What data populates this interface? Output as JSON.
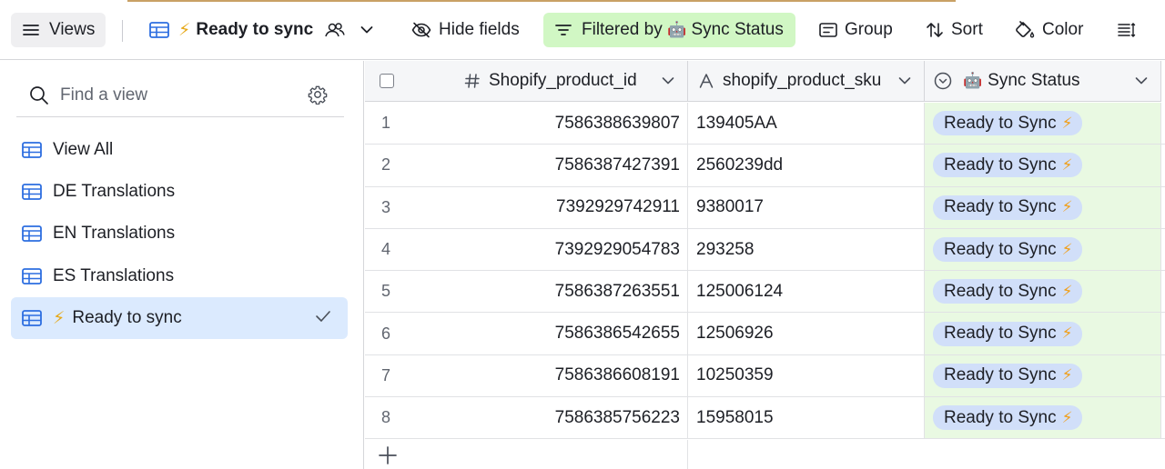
{
  "toolbar": {
    "views_label": "Views",
    "view_name": "Ready to sync",
    "view_bolt": "⚡",
    "hide_fields_label": "Hide fields",
    "filtered_label": "Filtered by",
    "filtered_field": "Sync Status",
    "filtered_emoji": "🤖",
    "group_label": "Group",
    "sort_label": "Sort",
    "color_label": "Color"
  },
  "sidebar": {
    "search_placeholder": "Find a view",
    "items": [
      {
        "label": "View All",
        "icon": "grid-view-icon"
      },
      {
        "label": "DE Translations",
        "icon": "grid-view-icon"
      },
      {
        "label": "EN Translations",
        "icon": "grid-view-icon"
      },
      {
        "label": "ES Translations",
        "icon": "grid-view-icon"
      },
      {
        "label": "Ready to sync",
        "icon": "grid-view-icon",
        "prefix": "⚡",
        "active": true
      }
    ]
  },
  "grid": {
    "columns": [
      {
        "name": "Shopify_product_id",
        "type_icon": "number-icon"
      },
      {
        "name": "shopify_product_sku",
        "type_icon": "text-icon"
      },
      {
        "name": "Sync Status",
        "type_icon": "single-select-icon",
        "emoji": "🤖"
      }
    ],
    "rows": [
      {
        "n": "1",
        "id": "7586388639807",
        "sku": "139405AA",
        "status": "Ready to Sync"
      },
      {
        "n": "2",
        "id": "7586387427391",
        "sku": "2560239dd",
        "status": "Ready to Sync"
      },
      {
        "n": "3",
        "id": "7392929742911",
        "sku": "9380017",
        "status": "Ready to Sync"
      },
      {
        "n": "4",
        "id": "7392929054783",
        "sku": "293258",
        "status": "Ready to Sync"
      },
      {
        "n": "5",
        "id": "7586387263551",
        "sku": "125006124",
        "status": "Ready to Sync"
      },
      {
        "n": "6",
        "id": "7586386542655",
        "sku": "12506926",
        "status": "Ready to Sync"
      },
      {
        "n": "7",
        "id": "7586386608191",
        "sku": "10250359",
        "status": "Ready to Sync"
      },
      {
        "n": "8",
        "id": "7586385756223",
        "sku": "15958015",
        "status": "Ready to Sync"
      }
    ],
    "status_bolt": "⚡"
  },
  "colors": {
    "accent_blue": "#2d6ee0",
    "filter_bg": "#d1f7c4",
    "status_cell_bg": "#e9f9e2",
    "pill_bg": "#d1dff9",
    "active_view_bg": "#dbeafe"
  }
}
